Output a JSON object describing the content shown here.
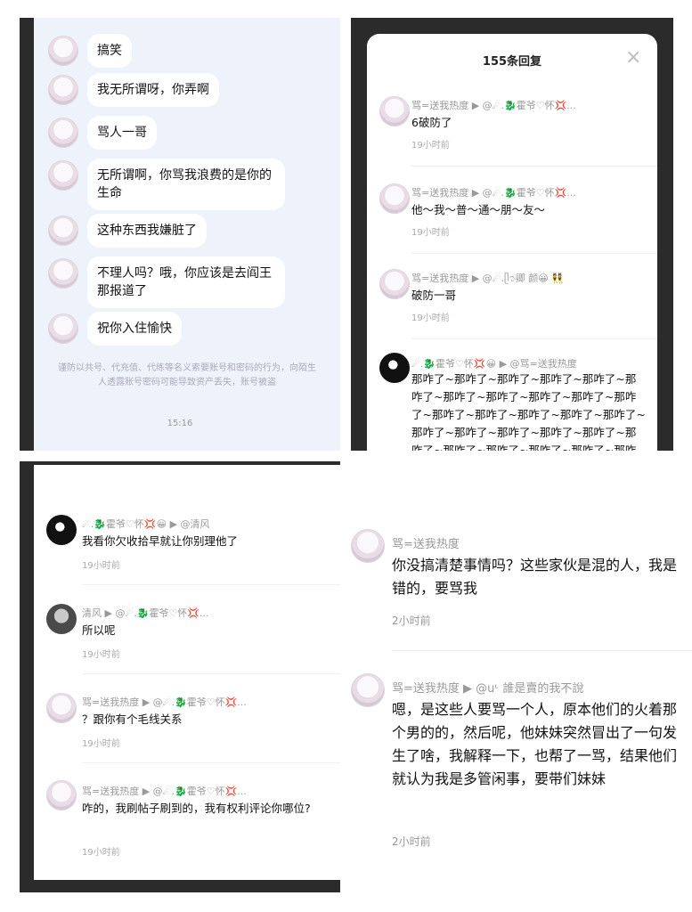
{
  "panel_chat": {
    "messages": [
      "搞笑",
      "我无所谓呀，你弄啊",
      "骂人一哥",
      "无所谓啊，你骂我浪费的是你的生命",
      "这种东西我嫌脏了",
      "不理人吗？哦，你应该是去阎王那报道了",
      "祝你入住愉快"
    ],
    "warning": "谨防以共号、代充值、代练等名义索要账号和密码的行为，向陌生人透露账号密码可能导致资产丢失，账号被盗",
    "time": "15:16"
  },
  "panel_replies": {
    "title": "155条回复",
    "comments": [
      {
        "meta": "骂=送我热度 ▶ @☄.🐉霍爷♡怀💢...",
        "text": "6破防了",
        "time": "19小时前"
      },
      {
        "meta": "骂=送我热度 ▶ @☄.🐉霍爷♡怀💢...",
        "text": "他～我～普～通～朋～友～",
        "time": "19小时前"
      },
      {
        "meta": "骂=送我热度 ▶ @☄.ᥫ᭡卿 颜😀 👯",
        "text": "破防一哥",
        "time": "19小时前"
      },
      {
        "meta": "☄.🐉霍爷♡怀💢😀 ▶ @骂=送我热度",
        "text": "那咋了~那咋了~那咋了~那咋了~那咋了~那咋了~那咋了~那咋了~那咋了~那咋了~那咋了~那咋了~那咋了~那咋了~那咋了~那咋了~那咋了~那咋了~那咋了~那咋了~那咋了~那咋了~那咋了~那咋了~那咋了~那咋了~那咋了~那咋了~那咋了~那咋了~",
        "time": ""
      }
    ]
  },
  "panel_thread": {
    "comments": [
      {
        "meta": "☄.🐉霍爷♡怀💢😀 ▶ @清风",
        "text": "我看你欠收拾早就让你别理他了",
        "time": "19小时前"
      },
      {
        "meta": "清风 ▶ @☄.🐉霍爷♡怀💢...",
        "text": "所以呢",
        "time": "19小时前"
      },
      {
        "meta": "骂=送我热度 ▶ @☄.🐉霍爷♡怀💢...",
        "text": "？跟你有个毛线关系",
        "time": "19小时前"
      },
      {
        "meta": "骂=送我热度 ▶ @☄.🐉霍爷♡怀💢...",
        "text": "咋的，我刷帖子刷到的，我有权利评论你哪位?",
        "time": "19小时前"
      }
    ]
  },
  "panel_zoom": {
    "comments": [
      {
        "meta": "骂=送我热度",
        "text": "你没搞清楚事情吗？这些家伙是混的人，我是错的，要骂我",
        "time": "2小时前"
      },
      {
        "meta": "骂=送我热度 ▶ @uᶫ 誰是賣的我不說",
        "text": "嗯，是这些人要骂一个人，原本他们的火着那个男的的，然后呢，他妹妹突然冒出了一句发生了啥，我解释一下，也帮了一骂，结果他们就认为我是多管闲事，要带们妹妹",
        "time": "2小时前"
      }
    ]
  }
}
